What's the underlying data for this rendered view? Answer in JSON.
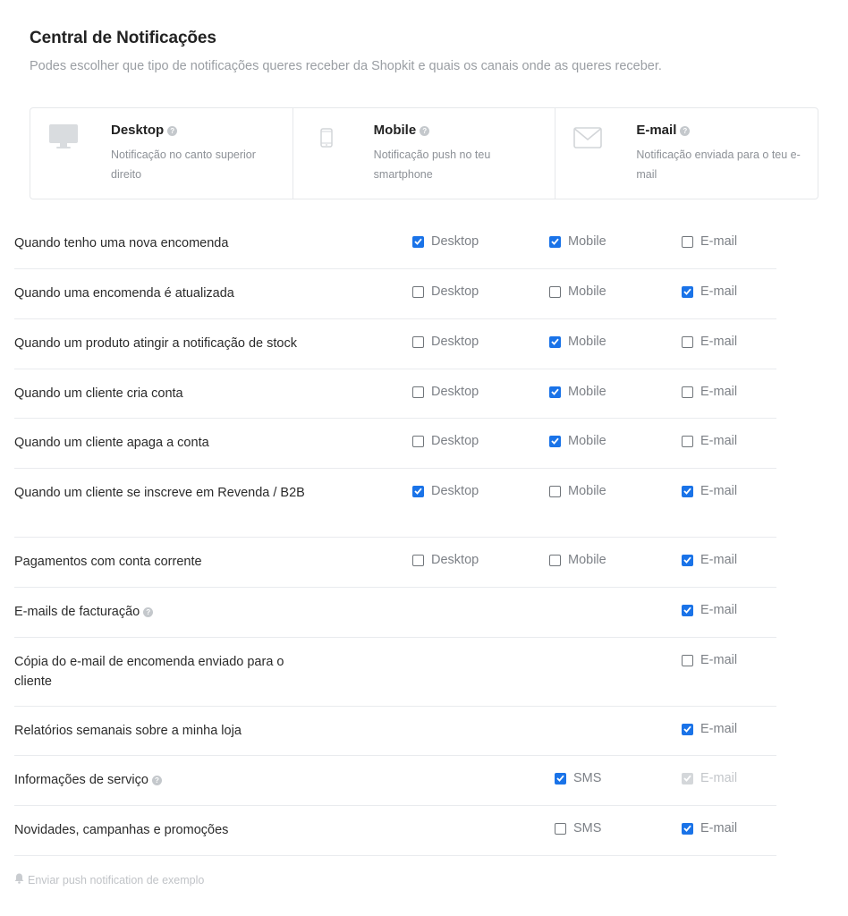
{
  "header": {
    "title": "Central de Notificações",
    "subtitle": "Podes escolher que tipo de notificações queres receber da Shopkit e quais os canais onde as queres receber."
  },
  "channels": [
    {
      "name": "Desktop",
      "icon": "monitor-icon",
      "description": "Notificação no canto superior direito"
    },
    {
      "name": "Mobile",
      "icon": "smartphone-icon",
      "description": "Notificação push no teu smartphone"
    },
    {
      "name": "E-mail",
      "icon": "envelope-icon",
      "description": "Notificação enviada para o teu e-mail"
    }
  ],
  "colors": {
    "accent": "#1a73e8",
    "muted_text": "#9a9ea3",
    "border": "#e6e8eb"
  },
  "rows": [
    {
      "label": "Quando tenho uma nova encomenda",
      "has_help": false,
      "options": [
        {
          "label": "Desktop",
          "checked": true
        },
        {
          "label": "Mobile",
          "checked": true
        },
        {
          "label": "E-mail",
          "checked": false
        }
      ]
    },
    {
      "label": "Quando uma encomenda é atualizada",
      "has_help": false,
      "options": [
        {
          "label": "Desktop",
          "checked": false
        },
        {
          "label": "Mobile",
          "checked": false
        },
        {
          "label": "E-mail",
          "checked": true
        }
      ]
    },
    {
      "label": "Quando um produto atingir a notificação de stock",
      "has_help": false,
      "options": [
        {
          "label": "Desktop",
          "checked": false
        },
        {
          "label": "Mobile",
          "checked": true
        },
        {
          "label": "E-mail",
          "checked": false
        }
      ]
    },
    {
      "label": "Quando um cliente cria conta",
      "has_help": false,
      "options": [
        {
          "label": "Desktop",
          "checked": false
        },
        {
          "label": "Mobile",
          "checked": true
        },
        {
          "label": "E-mail",
          "checked": false
        }
      ]
    },
    {
      "label": "Quando um cliente apaga a conta",
      "has_help": false,
      "options": [
        {
          "label": "Desktop",
          "checked": false
        },
        {
          "label": "Mobile",
          "checked": true
        },
        {
          "label": "E-mail",
          "checked": false
        }
      ]
    },
    {
      "label": "Quando um cliente se inscreve em Revenda / B2B",
      "has_help": false,
      "options": [
        {
          "label": "Desktop",
          "checked": true
        },
        {
          "label": "Mobile",
          "checked": false
        },
        {
          "label": "E-mail",
          "checked": true
        }
      ]
    },
    {
      "label": "Pagamentos com conta corrente",
      "has_help": false,
      "options": [
        {
          "label": "Desktop",
          "checked": false
        },
        {
          "label": "Mobile",
          "checked": false
        },
        {
          "label": "E-mail",
          "checked": true
        }
      ]
    },
    {
      "label": "E-mails de facturação",
      "has_help": true,
      "options": [
        {
          "label": "E-mail",
          "checked": true
        }
      ]
    },
    {
      "label": "Cópia do e-mail de encomenda enviado para o cliente",
      "has_help": false,
      "options": [
        {
          "label": "E-mail",
          "checked": false
        }
      ]
    },
    {
      "label": "Relatórios semanais sobre a minha loja",
      "has_help": false,
      "options": [
        {
          "label": "E-mail",
          "checked": true
        }
      ]
    },
    {
      "label": "Informações de serviço",
      "has_help": true,
      "options": [
        {
          "label": "SMS",
          "checked": true
        },
        {
          "label": "E-mail",
          "checked": true,
          "disabled": true
        }
      ]
    },
    {
      "label": "Novidades, campanhas e promoções",
      "has_help": false,
      "options": [
        {
          "label": "SMS",
          "checked": false
        },
        {
          "label": "E-mail",
          "checked": true
        }
      ]
    }
  ],
  "footer": {
    "push_link": "Enviar push notification de exemplo",
    "icon": "bell-icon"
  }
}
